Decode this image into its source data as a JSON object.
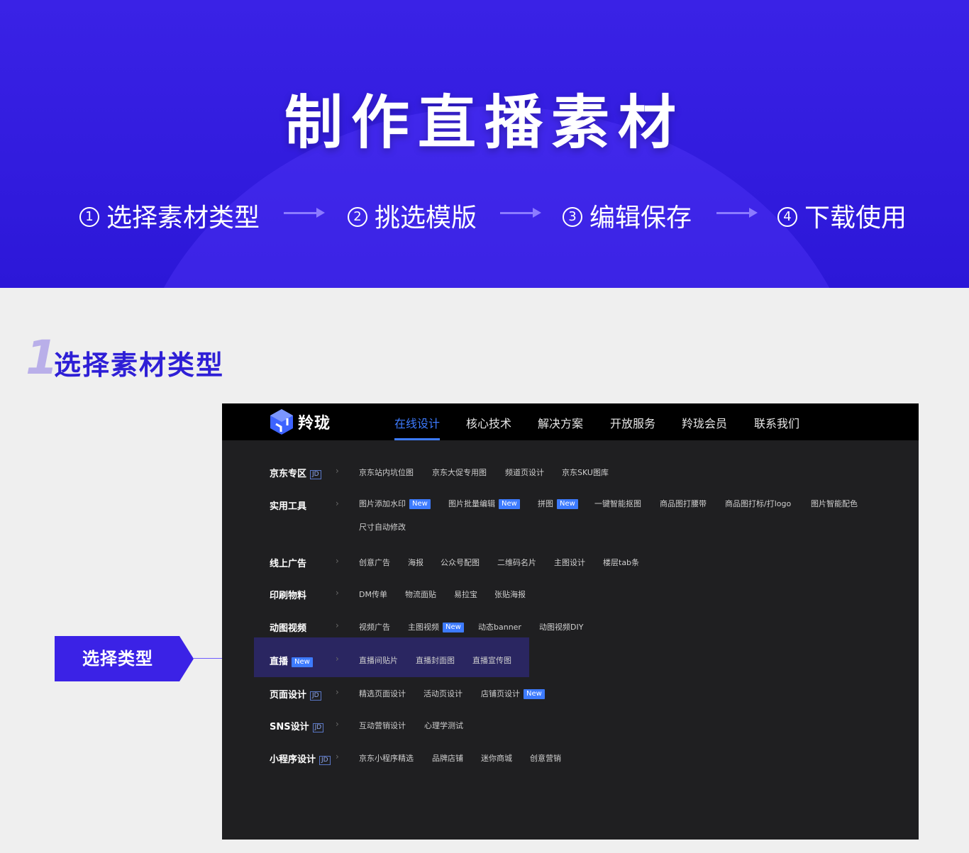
{
  "hero": {
    "title": "制作直播素材",
    "steps": [
      {
        "num": "1",
        "label": "选择素材类型"
      },
      {
        "num": "2",
        "label": "挑选模版"
      },
      {
        "num": "3",
        "label": "编辑保存"
      },
      {
        "num": "4",
        "label": "下载使用"
      }
    ]
  },
  "section": {
    "num": "1",
    "title": "选择素材类型"
  },
  "callout": {
    "label": "选择类型"
  },
  "app": {
    "logo_text": "羚珑",
    "nav": [
      "在线设计",
      "核心技术",
      "解决方案",
      "开放服务",
      "羚珑会员",
      "联系我们"
    ],
    "jd_badge": "JD",
    "new_badge": "New",
    "rows": [
      {
        "label": "京东专区",
        "items": [
          "京东站内坑位图",
          "京东大促专用图",
          "频道页设计",
          "京东SKU图库"
        ]
      },
      {
        "label": "实用工具",
        "items": [
          "图片添加水印",
          "图片批量编辑",
          "拼图",
          "一键智能抠图",
          "商品图打腰带",
          "商品图打标/打logo",
          "图片智能配色",
          "尺寸自动修改"
        ]
      },
      {
        "label": "线上广告",
        "items": [
          "创意广告",
          "海报",
          "公众号配图",
          "二维码名片",
          "主图设计",
          "楼层tab条"
        ]
      },
      {
        "label": "印刷物料",
        "items": [
          "DM传单",
          "物流面贴",
          "易拉宝",
          "张贴海报"
        ]
      },
      {
        "label": "动图视频",
        "items": [
          "视频广告",
          "主图视频",
          "动态banner",
          "动图视频DIY"
        ]
      },
      {
        "label": "直播",
        "items": [
          "直播间贴片",
          "直播封面图",
          "直播宣传图"
        ]
      },
      {
        "label": "页面设计",
        "items": [
          "精选页面设计",
          "活动页设计",
          "店铺页设计"
        ]
      },
      {
        "label": "SNS设计",
        "items": [
          "互动营销设计",
          "心理学测试"
        ]
      },
      {
        "label": "小程序设计",
        "items": [
          "京东小程序精选",
          "品牌店铺",
          "迷你商城",
          "创意营销"
        ]
      }
    ]
  },
  "colors": {
    "brand": "#3b22e6",
    "accent": "#3d7bff",
    "panel": "#1f1f21"
  }
}
